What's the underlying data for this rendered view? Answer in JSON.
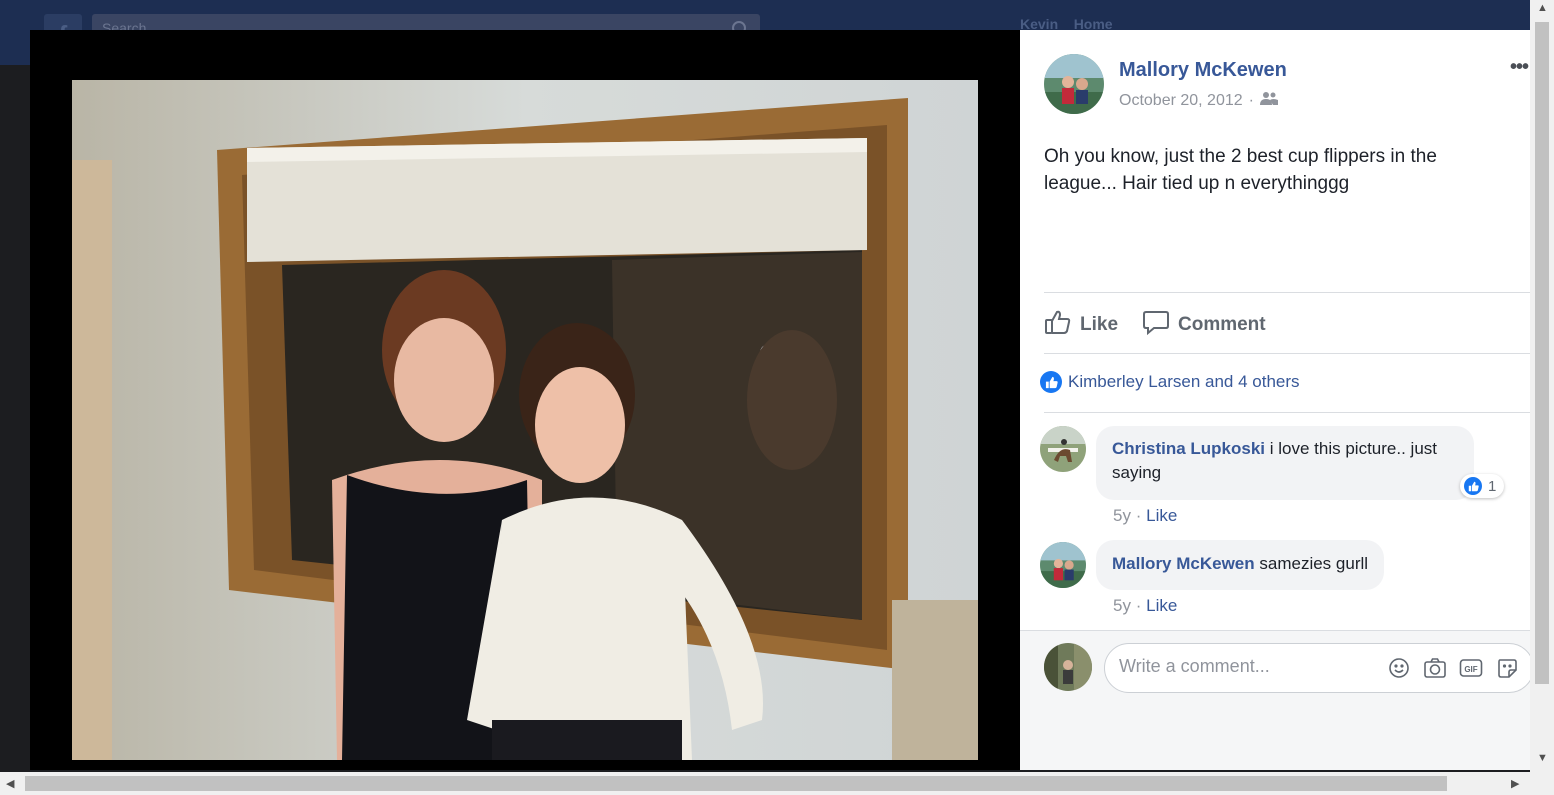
{
  "background": {
    "search_placeholder": "Search",
    "user_name": "Kevin",
    "home_label": "Home"
  },
  "post": {
    "author": "Mallory McKewen",
    "date": "October 20, 2012",
    "separator": "·",
    "audience_icon": "friends-icon",
    "more_label": "•••",
    "text": "Oh you know, just the 2 best cup flippers in the league... Hair tied up n everythinggg"
  },
  "actions": {
    "like_label": "Like",
    "comment_label": "Comment"
  },
  "reactions": {
    "summary": "Kimberley Larsen and 4 others"
  },
  "comments": [
    {
      "author": "Christina Lupkoski",
      "text": " i love this picture.. just saying",
      "age": "5y",
      "separator": "·",
      "like_label": "Like",
      "reaction_count": "1"
    },
    {
      "author": "Mallory McKewen",
      "text": " samezies gurll",
      "age": "5y",
      "separator": "·",
      "like_label": "Like"
    }
  ],
  "composer": {
    "placeholder": "Write a comment..."
  },
  "colors": {
    "link_blue": "#385898",
    "like_blue": "#1877f2",
    "stage": "#000000"
  }
}
